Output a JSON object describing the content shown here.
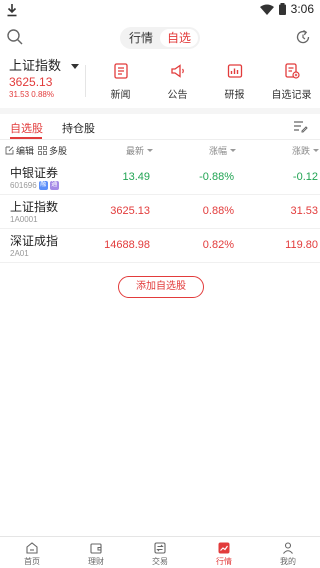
{
  "status": {
    "time": "3:06"
  },
  "header": {
    "tabs": [
      {
        "label": "行情"
      },
      {
        "label": "自选",
        "active": true
      }
    ]
  },
  "index_panel": {
    "name": "上证指数",
    "price": "3625.13",
    "change": "31.53",
    "change_pct": "0.88%"
  },
  "quick_actions": [
    {
      "label": "新闻",
      "icon": "news-icon"
    },
    {
      "label": "公告",
      "icon": "announcement-icon"
    },
    {
      "label": "研报",
      "icon": "research-icon"
    },
    {
      "label": "自选记录",
      "icon": "watchlist-record-icon"
    }
  ],
  "tabs": {
    "watchlist": "自选股",
    "holdings": "持仓股"
  },
  "list_header": {
    "edit": "编辑",
    "multi": "多股",
    "latest": "最新",
    "change_pct": "涨幅",
    "change": "涨跌"
  },
  "stocks": [
    {
      "name": "中银证券",
      "code": "601696",
      "tag1": "融",
      "tag2": "通",
      "price": "13.49",
      "change_pct": "-0.88%",
      "change": "-0.12",
      "direction": "down"
    },
    {
      "name": "上证指数",
      "code": "1A0001",
      "price": "3625.13",
      "change_pct": "0.88%",
      "change": "31.53",
      "direction": "up"
    },
    {
      "name": "深证成指",
      "code": "2A01",
      "price": "14688.98",
      "change_pct": "0.82%",
      "change": "119.80",
      "direction": "up"
    }
  ],
  "add_button": "添加自选股",
  "bottom_nav": [
    {
      "label": "首页",
      "icon": "home-icon"
    },
    {
      "label": "理财",
      "icon": "wallet-icon"
    },
    {
      "label": "交易",
      "icon": "trade-icon"
    },
    {
      "label": "行情",
      "icon": "market-icon",
      "active": true
    },
    {
      "label": "我的",
      "icon": "profile-icon"
    }
  ],
  "colors": {
    "accent": "#e23b3b",
    "up": "#e23b3b",
    "down": "#21a453"
  }
}
